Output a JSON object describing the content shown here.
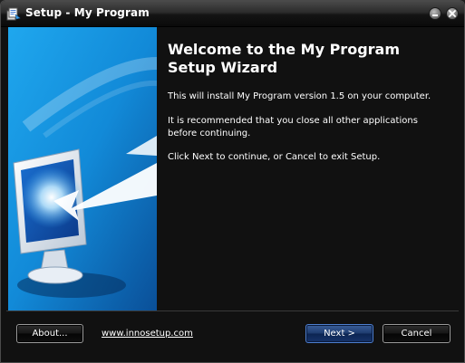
{
  "window": {
    "title": "Setup - My Program",
    "app_icon": "installer-icon",
    "minimize_icon": "minimize-icon",
    "close_icon": "close-icon"
  },
  "banner": {
    "image": "monitor-with-arrow-illustration",
    "colors": {
      "sky": "#1a9ee8",
      "deep": "#0b4f9a"
    }
  },
  "content": {
    "heading": "Welcome to the My Program Setup Wizard",
    "paragraphs": [
      "This will install My Program version 1.5 on your computer.",
      "It is recommended that you close all other applications before continuing.",
      "Click Next to continue, or Cancel to exit Setup."
    ]
  },
  "footer": {
    "about_label": "About...",
    "link_text": "www.innosetup.com",
    "next_label": "Next >",
    "cancel_label": "Cancel"
  },
  "colors": {
    "background": "#111111",
    "text": "#ffffff",
    "accent_button_border": "#4d7fd0"
  }
}
